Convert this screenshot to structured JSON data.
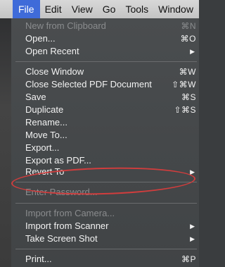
{
  "menubar": {
    "items": [
      "File",
      "Edit",
      "View",
      "Go",
      "Tools",
      "Window"
    ]
  },
  "file_menu": {
    "new_from_clipboard": {
      "label": "New from Clipboard",
      "shortcut": "⌘N"
    },
    "open": {
      "label": "Open...",
      "shortcut": "⌘O"
    },
    "open_recent": {
      "label": "Open Recent"
    },
    "close_window": {
      "label": "Close Window",
      "shortcut": "⌘W"
    },
    "close_selected": {
      "label": "Close Selected PDF Document",
      "shortcut": "⇧⌘W"
    },
    "save": {
      "label": "Save",
      "shortcut": "⌘S"
    },
    "duplicate": {
      "label": "Duplicate",
      "shortcut": "⇧⌘S"
    },
    "rename": {
      "label": "Rename..."
    },
    "move_to": {
      "label": "Move To..."
    },
    "export": {
      "label": "Export..."
    },
    "export_pdf": {
      "label": "Export as PDF..."
    },
    "revert_to": {
      "label": "Revert To"
    },
    "enter_password": {
      "label": "Enter Password..."
    },
    "import_camera": {
      "label": "Import from Camera..."
    },
    "import_scanner": {
      "label": "Import from Scanner"
    },
    "take_screenshot": {
      "label": "Take Screen Shot"
    },
    "print": {
      "label": "Print...",
      "shortcut": "⌘P"
    }
  },
  "colors": {
    "menu_bg": "#45484a",
    "menubar_active": "#3f6bd9",
    "annotation": "#d13d3d"
  }
}
